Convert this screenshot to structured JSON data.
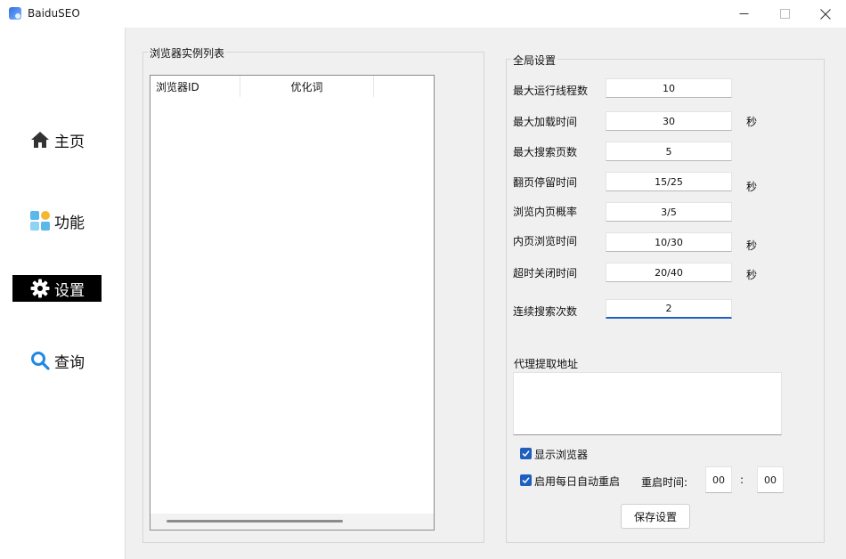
{
  "window": {
    "title": "BaiduSEO",
    "icons": {
      "app": "app-logo-icon",
      "minimize": "minimize-icon",
      "maximize": "maximize-icon",
      "close": "close-icon"
    }
  },
  "sidebar": {
    "items": [
      {
        "label": "主页",
        "icon": "home-icon",
        "active": false
      },
      {
        "label": "功能",
        "icon": "grid-icon",
        "active": false
      },
      {
        "label": "设置",
        "icon": "gear-icon",
        "active": true
      },
      {
        "label": "查询",
        "icon": "search-icon",
        "active": false
      }
    ]
  },
  "browser_list": {
    "title": "浏览器实例列表",
    "columns": [
      "浏览器ID",
      "优化词"
    ],
    "rows": []
  },
  "settings": {
    "title": "全局设置",
    "fields": [
      {
        "label": "最大运行线程数",
        "value": "10",
        "unit": ""
      },
      {
        "label": "最大加载时间",
        "value": "30",
        "unit": "秒"
      },
      {
        "label": "最大搜索页数",
        "value": "5",
        "unit": ""
      },
      {
        "label": "翻页停留时间",
        "value": "15/25",
        "unit": "秒"
      },
      {
        "label": "浏览内页概率",
        "value": "3/5",
        "unit": ""
      },
      {
        "label": "内页浏览时间",
        "value": "10/30",
        "unit": "秒"
      },
      {
        "label": "超时关闭时间",
        "value": "20/40",
        "unit": "秒"
      },
      {
        "label": "连续搜索次数",
        "value": "2",
        "unit": ""
      }
    ],
    "proxy": {
      "label": "代理提取地址",
      "value": ""
    },
    "show_browser": {
      "label": "显示浏览器",
      "checked": true
    },
    "auto_restart": {
      "label": "启用每日自动重启",
      "checked": true
    },
    "restart_time": {
      "label": "重启时间:",
      "hour": "00",
      "separator": ":",
      "minute": "00"
    },
    "save_label": "保存设置"
  },
  "colors": {
    "active_nav_bg": "#000000",
    "checkbox": "#1e5fbf",
    "search_icon": "#1e88e5",
    "focus_underline": "#1e5fbf"
  }
}
